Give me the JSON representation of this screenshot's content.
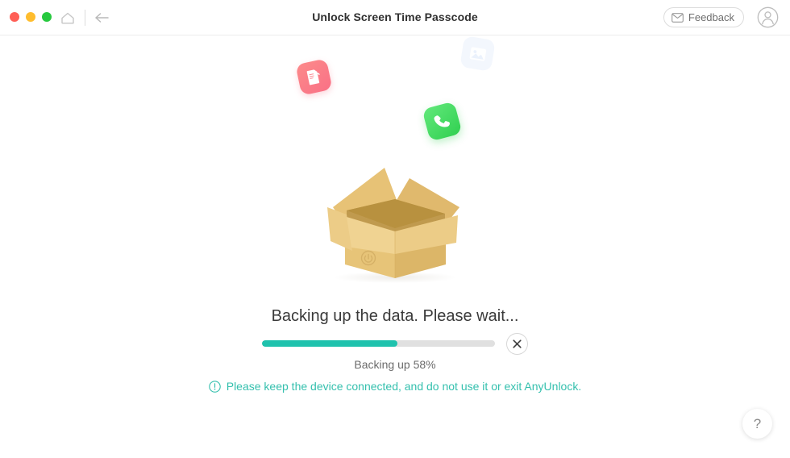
{
  "window": {
    "title": "Unlock Screen Time Passcode",
    "traffic_lights": [
      {
        "name": "close",
        "color": "#ff5f56"
      },
      {
        "name": "minimize",
        "color": "#ffbd2e"
      },
      {
        "name": "zoom",
        "color": "#27c93f"
      }
    ]
  },
  "toolbar": {
    "home_icon": "home-icon",
    "back_icon": "back-arrow-icon",
    "feedback_label": "Feedback",
    "feedback_icon": "envelope-icon",
    "account_icon": "user-account-icon"
  },
  "decorations": {
    "icons": [
      {
        "name": "music-document-icon",
        "color": "#f97186"
      },
      {
        "name": "photos-icon",
        "color": "#eaf1fd"
      },
      {
        "name": "phone-icon",
        "color": "#31d051"
      }
    ],
    "illustration": "open-cardboard-box"
  },
  "main": {
    "status_title": "Backing up the data. Please wait...",
    "progress_percent": 58,
    "progress_label": "Backing up 58%",
    "progress_fill_color": "#1fc2ad",
    "progress_track_color": "#e0e0e0",
    "cancel_icon": "close-icon",
    "notice_icon": "exclamation-circle-icon",
    "notice_text": "Please keep the device connected, and do not use it or exit AnyUnlock.",
    "notice_color": "#35c0ae"
  },
  "help": {
    "label": "?"
  }
}
